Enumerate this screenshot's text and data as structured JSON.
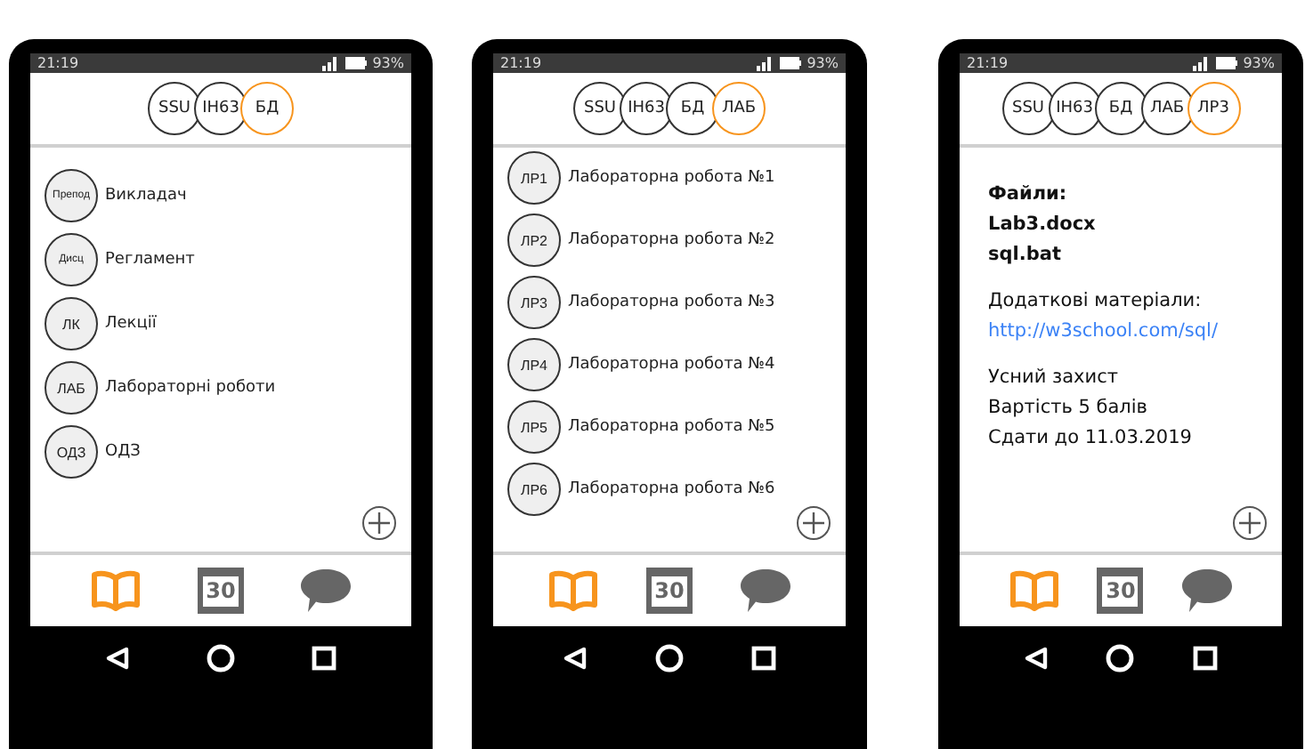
{
  "phones": [
    {
      "status": {
        "time": "21:19",
        "battery": "93%"
      },
      "breadcrumbs": [
        {
          "label": "SSU",
          "selected": false
        },
        {
          "label": "ІН63",
          "selected": false
        },
        {
          "label": "БД",
          "selected": true
        }
      ],
      "content": {
        "kind": "list",
        "items": [
          {
            "badge": "Препод",
            "label": "Викладач"
          },
          {
            "badge": "Дисц",
            "label": "Регламент"
          },
          {
            "badge": "ЛК",
            "label": "Лекції"
          },
          {
            "badge": "ЛАБ",
            "label": "Лабораторні роботи"
          },
          {
            "badge": "ОДЗ",
            "label": "ОДЗ"
          }
        ]
      },
      "tabs": [
        {
          "kind": "book",
          "selected": true
        },
        {
          "kind": "calendar",
          "label": "30",
          "selected": false
        },
        {
          "kind": "chat",
          "selected": false
        }
      ]
    },
    {
      "status": {
        "time": "21:19",
        "battery": "93%"
      },
      "breadcrumbs": [
        {
          "label": "SSU",
          "selected": false
        },
        {
          "label": "ІН63",
          "selected": false
        },
        {
          "label": "БД",
          "selected": false
        },
        {
          "label": "ЛАБ",
          "selected": true
        }
      ],
      "content": {
        "kind": "list",
        "items": [
          {
            "badge": "ЛР1",
            "label": "Лабораторна робота №1"
          },
          {
            "badge": "ЛР2",
            "label": "Лабораторна робота №2"
          },
          {
            "badge": "ЛР3",
            "label": "Лабораторна робота №3"
          },
          {
            "badge": "ЛР4",
            "label": "Лабораторна робота №4"
          },
          {
            "badge": "ЛР5",
            "label": "Лабораторна робота №5"
          },
          {
            "badge": "ЛР6",
            "label": "Лабораторна робота №6"
          }
        ]
      },
      "tabs": [
        {
          "kind": "book",
          "selected": true
        },
        {
          "kind": "calendar",
          "label": "30",
          "selected": false
        },
        {
          "kind": "chat",
          "selected": false
        }
      ]
    },
    {
      "status": {
        "time": "21:19",
        "battery": "93%"
      },
      "breadcrumbs": [
        {
          "label": "SSU",
          "selected": false
        },
        {
          "label": "ІН63",
          "selected": false
        },
        {
          "label": "БД",
          "selected": false
        },
        {
          "label": "ЛАБ",
          "selected": false
        },
        {
          "label": "ЛР3",
          "selected": true
        }
      ],
      "content": {
        "kind": "details",
        "sections": [
          [
            {
              "kind": "bold",
              "text": "Файли:"
            },
            {
              "kind": "bold",
              "text": "Lab3.docx"
            },
            {
              "kind": "bold",
              "text": "sql.bat"
            }
          ],
          [
            {
              "kind": "text",
              "text": "Додаткові матеріали:"
            },
            {
              "kind": "link",
              "text": "http://w3school.com/sql/"
            }
          ],
          [
            {
              "kind": "text",
              "text": "Усний захист"
            },
            {
              "kind": "text",
              "text": "Вартість 5 балів"
            },
            {
              "kind": "text",
              "text": "Сдати до 11.03.2019"
            }
          ]
        ]
      },
      "tabs": [
        {
          "kind": "book",
          "selected": true
        },
        {
          "kind": "calendar",
          "label": "30",
          "selected": false
        },
        {
          "kind": "chat",
          "selected": false
        }
      ]
    }
  ]
}
